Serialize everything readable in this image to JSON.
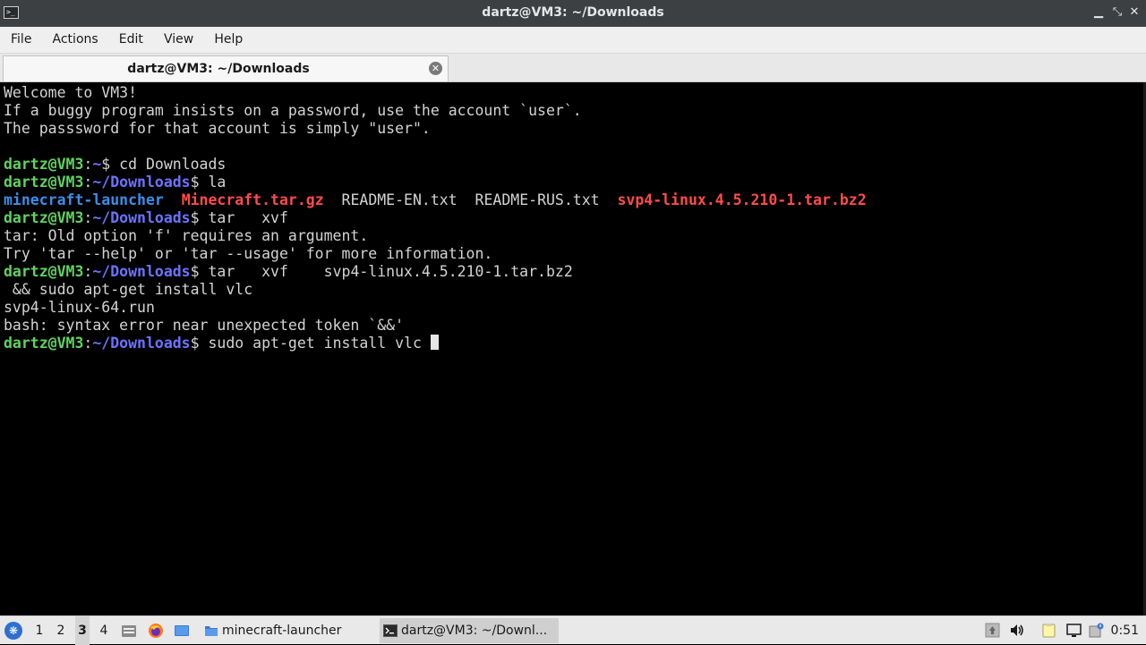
{
  "window": {
    "title": "dartz@VM3: ~/Downloads",
    "minimize_glyph": "▁",
    "restore_glyph": "⤡",
    "close_glyph": "✕"
  },
  "menu": {
    "items": [
      "File",
      "Actions",
      "Edit",
      "View",
      "Help"
    ]
  },
  "tab": {
    "label": "dartz@VM3: ~/Downloads",
    "close_glyph": "✕"
  },
  "terminal": {
    "motd": [
      "Welcome to VM3!",
      "If a buggy program insists on a password, use the account `user`.",
      "The passsword for that account is simply \"user\"."
    ],
    "prompt_user": "dartz@VM3",
    "prompt_sep": ":",
    "prompt_home": "~",
    "prompt_downloads": "~/Downloads",
    "prompt_dollar": "$",
    "cmd1": " cd Downloads",
    "cmd2": " la",
    "ls": {
      "exec": "minecraft-launcher",
      "archive1": "Minecraft.tar.gz",
      "file1": "README-EN.txt",
      "file2": "README-RUS.txt",
      "archive2": "svp4-linux.4.5.210-1.tar.bz2"
    },
    "cmd3": " tar   xvf",
    "err1": "tar: Old option 'f' requires an argument.",
    "err2": "Try 'tar --help' or 'tar --usage' for more information.",
    "cmd4": " tar   xvf    svp4-linux.4.5.210-1.tar.bz2",
    "out1": " && sudo apt-get install vlc",
    "out2": "svp4-linux-64.run",
    "out3": "bash: syntax error near unexpected token `&&'",
    "cmd5": " sudo apt-get install vlc "
  },
  "taskbar": {
    "desktops": [
      "1",
      "2",
      "3",
      "4"
    ],
    "active_desktop": "3",
    "tasks": [
      {
        "label": "minecraft-launcher"
      },
      {
        "label": "dartz@VM3: ~/Downl..."
      }
    ],
    "clock": "0:51"
  },
  "colors": {
    "prompt_user": "#5fd35f",
    "prompt_path": "#6b73ff",
    "executable": "#3b8eea",
    "archive": "#ff4b4b"
  }
}
